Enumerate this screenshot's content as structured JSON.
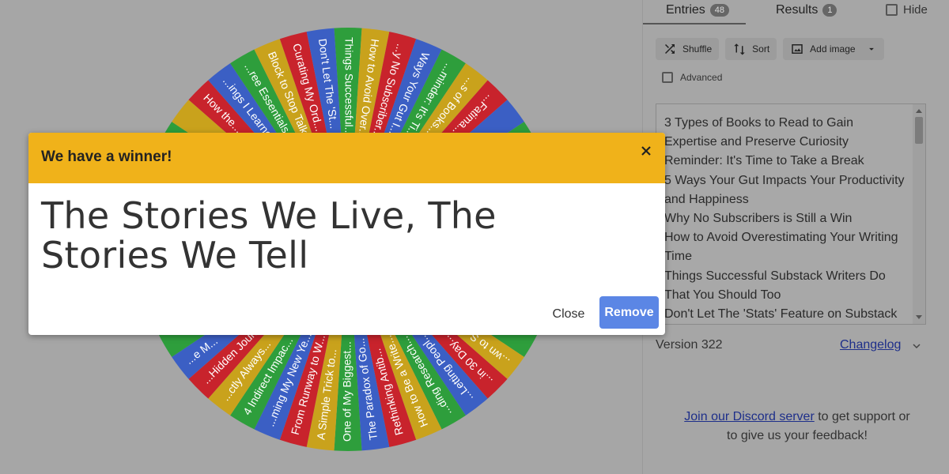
{
  "tabs": {
    "entries_label": "Entries",
    "entries_count": "48",
    "results_label": "Results",
    "results_count": "1",
    "hide_label": "Hide"
  },
  "toolbar": {
    "shuffle_label": "Shuffle",
    "sort_label": "Sort",
    "add_image_label": "Add image",
    "advanced_label": "Advanced"
  },
  "entries": [
    "3 Types of Books to Read to Gain Expertise and Preserve Curiosity",
    "Reminder: It's Time to Take a Break",
    "5 Ways Your Gut Impacts Your Productivity and Happiness",
    "Why No Subscribers is Still a Win",
    "How to Avoid Overestimating Your Writing Time",
    "Things Successful Substack Writers Do That You Should Too",
    "Don't Let The 'Stats' Feature on Substack"
  ],
  "version": {
    "text": "Version 322",
    "changelog_label": "Changelog"
  },
  "discord": {
    "link_text": "Join our Discord server",
    "rest_text": " to get support or to give us your feedback!"
  },
  "dialog": {
    "title": "We have a winner!",
    "winner": "The Stories We Live, The Stories We Tell",
    "close_label": "Close",
    "remove_label": "Remove"
  },
  "wheel": {
    "colors": [
      "#2e9e3c",
      "#c9a21c",
      "#c8232c",
      "#3b5fc4"
    ],
    "visible_labels_top": [
      "How the...",
      "...ings I Learne...",
      "...ree Essentials...",
      "Block to Stop Talk...",
      "Curating My Ord...",
      "Don't Let The 'St...",
      "Things Successful...",
      "How to Avoid Over...",
      "...y No Subscriber...",
      "Ways Your Gut I...",
      "...minder: It's Ti...",
      "...s of Books...",
      "...Fatima..."
    ],
    "visible_labels_bottom": [
      "...e M...",
      "...Hidden Journe...",
      "...ctly Always...",
      "4 Indirect Impac...",
      "...ming My New Ye...",
      "From Runway to W...",
      "A Simple Trick to...",
      "One of My Biggest...",
      "The Paradox of Go...",
      "Rethinking Antib...",
      "How to Be a Write...",
      "...ding Research...",
      "...Letting Peopl...",
      "...in 30 Day...",
      "...wn to S..."
    ]
  }
}
